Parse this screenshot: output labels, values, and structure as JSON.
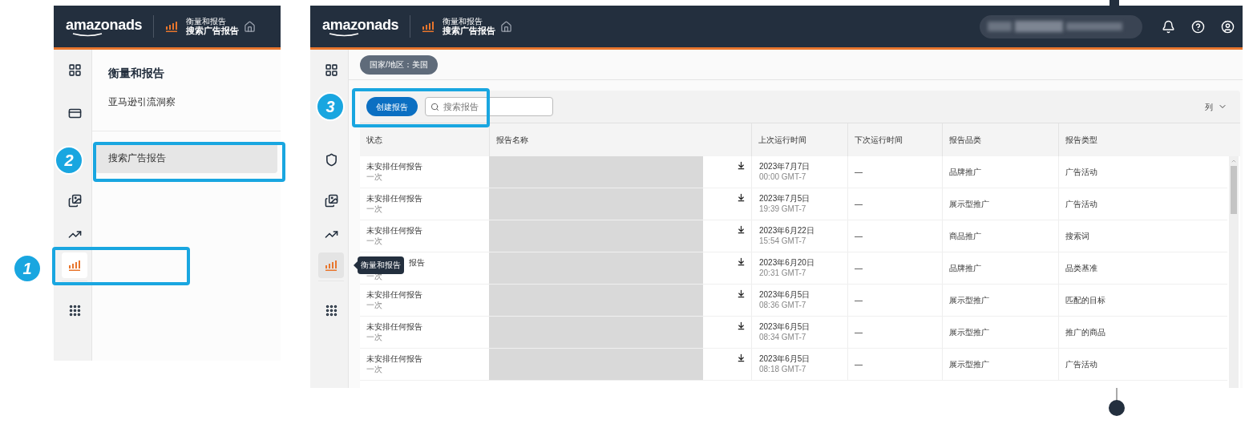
{
  "left_panel": {
    "header": {
      "logo": "amazonads",
      "breadcrumb_parent": "衡量和报告",
      "breadcrumb_current": "搜索广告报告"
    },
    "rail": [
      {
        "kind": "dashboard",
        "selected": false
      },
      {
        "kind": "wallet",
        "selected": false
      },
      {
        "kind": "gallery",
        "selected": false
      },
      {
        "kind": "trend",
        "selected": false
      },
      {
        "kind": "reports",
        "selected": true
      },
      {
        "kind": "apps",
        "selected": false
      }
    ],
    "submenu": {
      "title": "衡量和报告",
      "items": [
        {
          "label": "亚马逊引流洞察",
          "selected": false
        },
        {
          "label": "搜索广告报告",
          "selected": true
        }
      ]
    }
  },
  "right_panel": {
    "header": {
      "logo": "amazonads",
      "breadcrumb_parent": "衡量和报告",
      "breadcrumb_current": "搜索广告报告"
    },
    "rail": [
      {
        "kind": "dashboard",
        "selected": false
      },
      {
        "kind": "shield",
        "selected": false
      },
      {
        "kind": "gallery",
        "selected": false
      },
      {
        "kind": "trend",
        "selected": false
      },
      {
        "kind": "reports",
        "selected": true
      },
      {
        "kind": "apps",
        "selected": false
      }
    ],
    "tooltip": "衡量和报告",
    "country_filter": "国家/地区：美国",
    "create_button": "创建报告",
    "search": {
      "placeholder": "搜索报告"
    },
    "columns_button": "列",
    "table": {
      "columns": [
        "状态",
        "报告名称",
        "上次运行时间",
        "下次运行时间",
        "报告品类",
        "报告类型"
      ],
      "rows": [
        {
          "status": "未安排任何报告",
          "frequency": "一次",
          "last_run_date": "2023年7月7日",
          "last_run_time": "00:00 GMT-7",
          "next_run": "—",
          "category": "品牌推广",
          "type": "广告活动"
        },
        {
          "status": "未安排任何报告",
          "frequency": "一次",
          "last_run_date": "2023年7月5日",
          "last_run_time": "19:39 GMT-7",
          "next_run": "—",
          "category": "展示型推广",
          "type": "广告活动"
        },
        {
          "status": "未安排任何报告",
          "frequency": "一次",
          "last_run_date": "2023年6月22日",
          "last_run_time": "15:54 GMT-7",
          "next_run": "—",
          "category": "商品推广",
          "type": "搜索词"
        },
        {
          "status": "报告",
          "frequency": "一次",
          "last_run_date": "2023年6月20日",
          "last_run_time": "20:31 GMT-7",
          "next_run": "—",
          "category": "品牌推广",
          "type": "品类基准"
        },
        {
          "status": "未安排任何报告",
          "frequency": "一次",
          "last_run_date": "2023年6月5日",
          "last_run_time": "08:36 GMT-7",
          "next_run": "—",
          "category": "展示型推广",
          "type": "匹配的目标"
        },
        {
          "status": "未安排任何报告",
          "frequency": "一次",
          "last_run_date": "2023年6月5日",
          "last_run_time": "08:34 GMT-7",
          "next_run": "—",
          "category": "展示型推广",
          "type": "推广的商品"
        },
        {
          "status": "未安排任何报告",
          "frequency": "一次",
          "last_run_date": "2023年6月5日",
          "last_run_time": "08:18 GMT-7",
          "next_run": "—",
          "category": "展示型推广",
          "type": "广告活动"
        }
      ]
    }
  },
  "annotations": [
    {
      "number": "1"
    },
    {
      "number": "2"
    },
    {
      "number": "3"
    }
  ]
}
